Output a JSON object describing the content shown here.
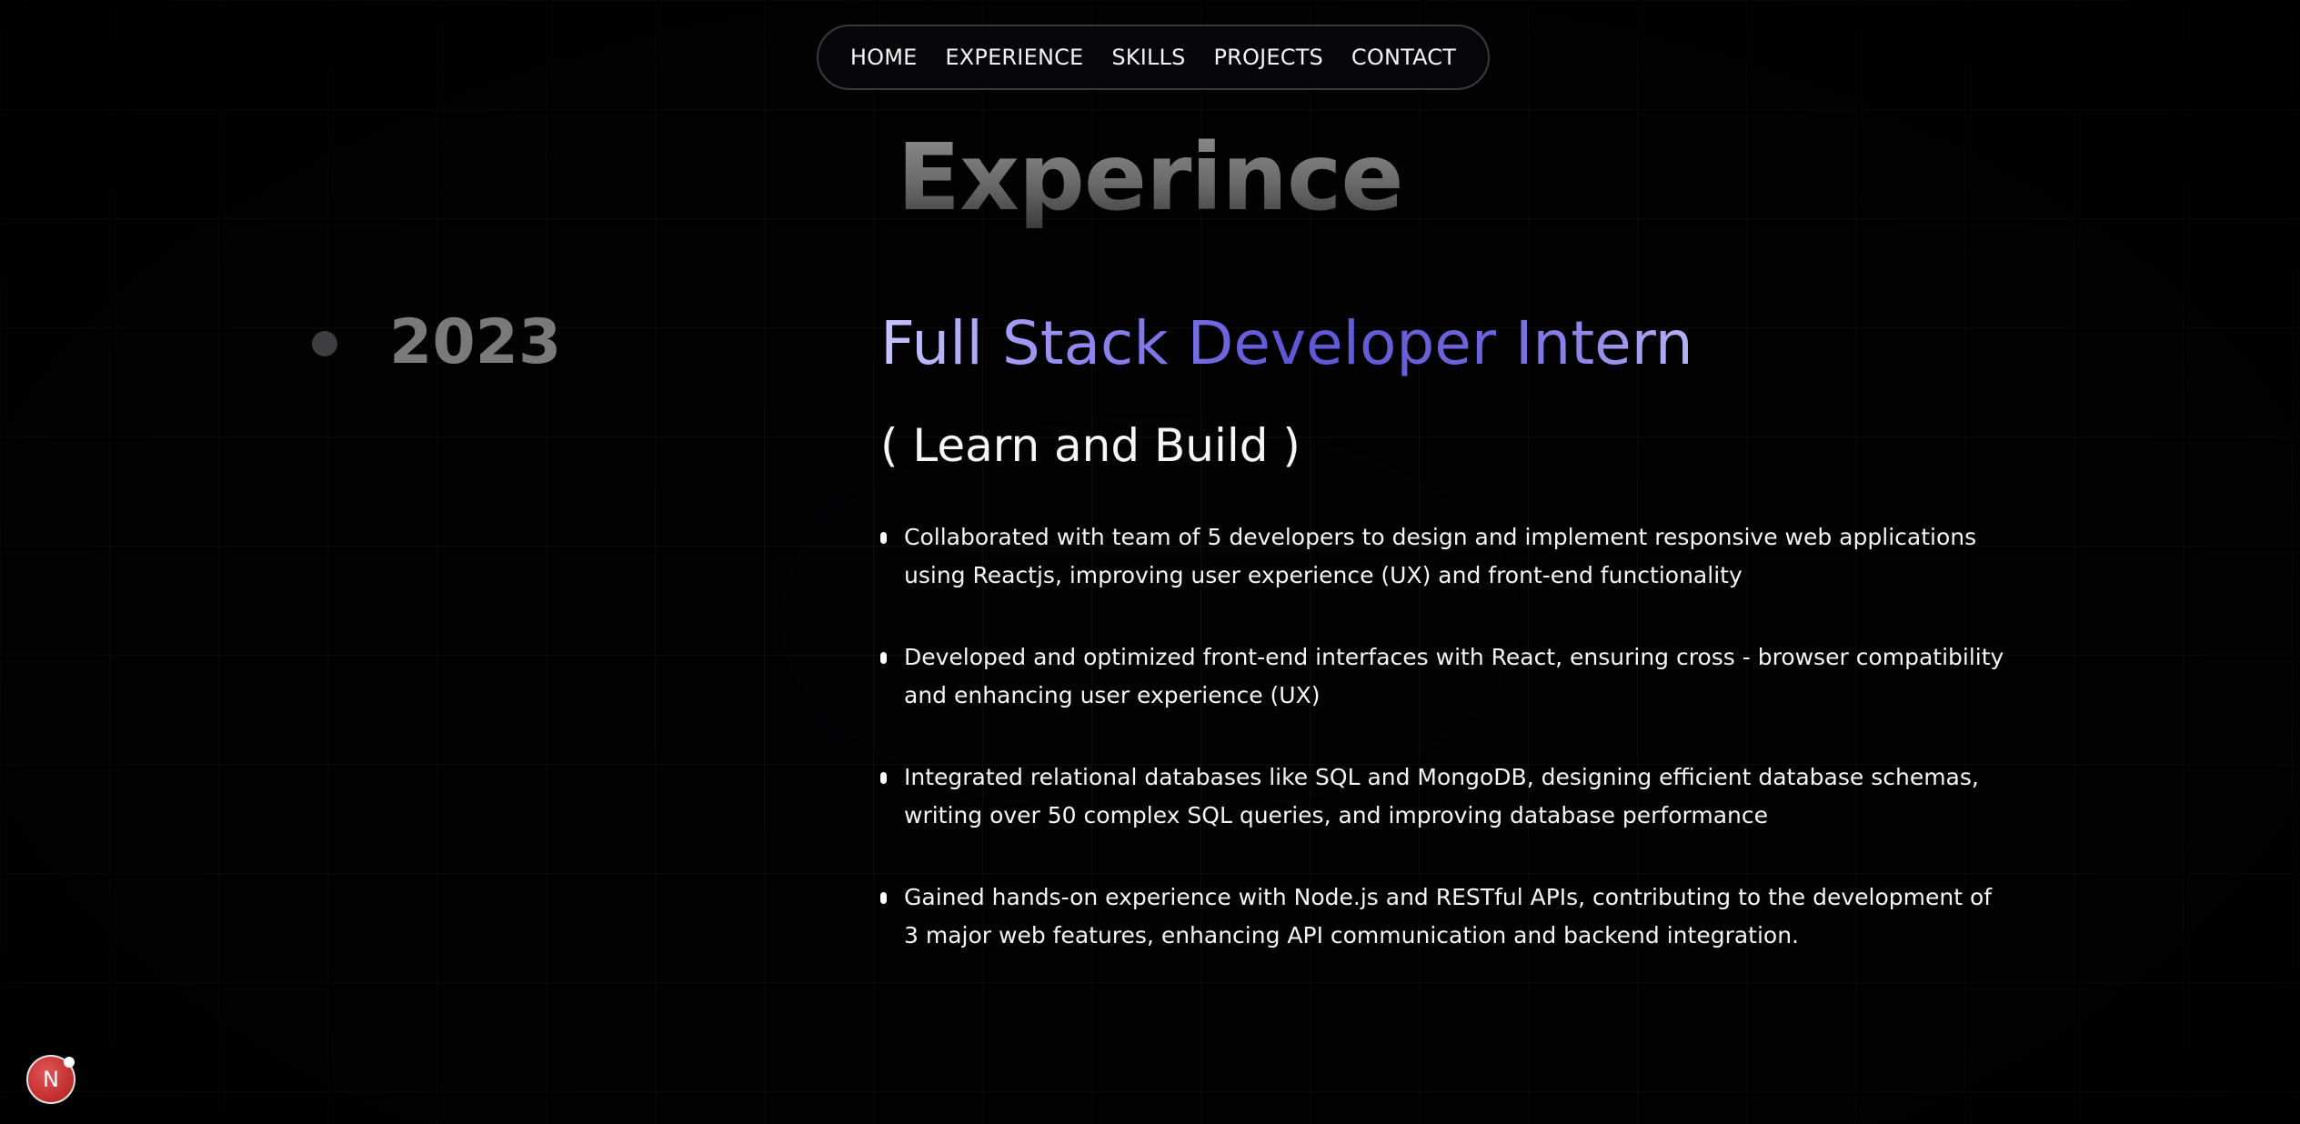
{
  "nav": {
    "items": [
      {
        "label": "HOME"
      },
      {
        "label": "EXPERIENCE"
      },
      {
        "label": "SKILLS"
      },
      {
        "label": "PROJECTS"
      },
      {
        "label": "CONTACT"
      }
    ]
  },
  "section": {
    "title": "Experince"
  },
  "experience": {
    "year": "2023",
    "role": "Full Stack Developer Intern",
    "subtitle": "( Learn and Build )",
    "duties": [
      "Collaborated with team of 5 developers to design and implement responsive web applications using Reactjs, improving user experience (UX) and front-end functionality",
      "Developed and optimized front-end interfaces with React, ensuring cross - browser compatibility and enhancing user experience (UX)",
      "Integrated relational databases like SQL and MongoDB, designing efficient database schemas, writing over 50 complex SQL queries, and improving database performance",
      "Gained hands-on experience with Node.js and RESTful APIs, contributing to the development of 3 major web features, enhancing API communication and backend integration."
    ]
  },
  "badge": {
    "letter": "N",
    "icon": "nextjs-dev-indicator-icon"
  },
  "colors": {
    "background": "#030304",
    "accent_purple": "#5f56d6",
    "accent_light": "#c9c4ff",
    "title_gray": "#7a7a7a",
    "badge_red": "#c43232"
  }
}
